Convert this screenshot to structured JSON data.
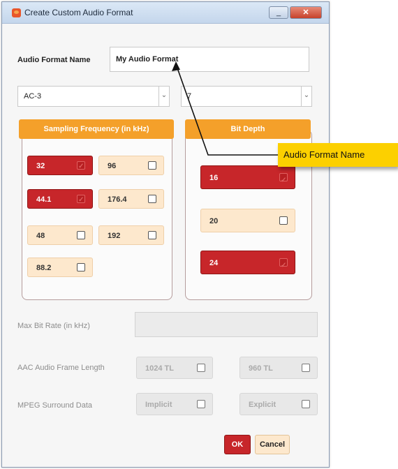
{
  "window": {
    "title": "Create Custom Audio Format",
    "minimize_label": "_",
    "close_label": "✕"
  },
  "audio_format_name": {
    "label": "Audio Format Name",
    "value": "My Audio Format"
  },
  "codec_select": {
    "value": "AC-3",
    "arrow": "⌄"
  },
  "channels_select": {
    "value": "7",
    "arrow": "⌄"
  },
  "sampling": {
    "header": "Sampling Frequency (in kHz)",
    "options": [
      {
        "label": "32",
        "checked": true
      },
      {
        "label": "96",
        "checked": false
      },
      {
        "label": "44.1",
        "checked": true
      },
      {
        "label": "176.4",
        "checked": false
      },
      {
        "label": "48",
        "checked": false
      },
      {
        "label": "192",
        "checked": false
      },
      {
        "label": "88.2",
        "checked": false
      }
    ]
  },
  "bit_depth": {
    "header": "Bit Depth",
    "options": [
      {
        "label": "16",
        "checked": true
      },
      {
        "label": "20",
        "checked": false
      },
      {
        "label": "24",
        "checked": true
      }
    ]
  },
  "max_bit_rate": {
    "label": "Max Bit Rate (in kHz)",
    "value": ""
  },
  "aac_frame_length": {
    "label": "AAC Audio Frame Length",
    "options": [
      {
        "label": "1024 TL"
      },
      {
        "label": "960 TL"
      }
    ]
  },
  "mpeg_surround": {
    "label": "MPEG Surround Data",
    "options": [
      {
        "label": "Implicit"
      },
      {
        "label": "Explicit"
      }
    ]
  },
  "buttons": {
    "ok": "OK",
    "cancel": "Cancel"
  },
  "callout": {
    "text": "Audio Format Name"
  },
  "colors": {
    "accent_orange": "#f4a02a",
    "selected_red": "#c7262a",
    "unselected_cream": "#fde8cd",
    "callout_yellow": "#fcd000"
  }
}
